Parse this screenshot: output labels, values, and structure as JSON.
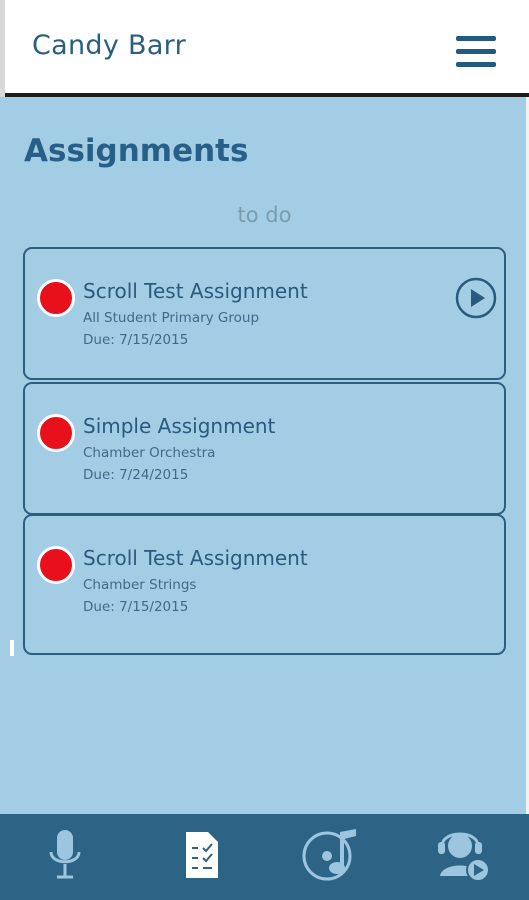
{
  "header": {
    "title": "Candy Barr",
    "menu_icon": "hamburger-menu-icon"
  },
  "main": {
    "title": "Assignments",
    "section_label": "to do",
    "assignments": [
      {
        "title": "Scroll Test Assignment",
        "group": "All Student Primary Group",
        "due": "Due: 7/15/2015",
        "status_color": "#e8101b",
        "has_play": true
      },
      {
        "title": "Simple Assignment",
        "group": "Chamber Orchestra",
        "due": "Due: 7/24/2015",
        "status_color": "#e8101b",
        "has_play": false
      },
      {
        "title": "Scroll Test Assignment",
        "group": "Chamber Strings",
        "due": "Due: 7/15/2015",
        "status_color": "#e8101b",
        "has_play": false
      }
    ]
  },
  "bottom_nav": {
    "items": [
      {
        "icon": "microphone-icon"
      },
      {
        "icon": "assignment-checklist-icon",
        "active": true
      },
      {
        "icon": "music-disc-icon"
      },
      {
        "icon": "support-headset-icon"
      }
    ]
  },
  "colors": {
    "background": "#a2cde4",
    "accent": "#285f86",
    "status_red": "#e8101b",
    "nav_bar": "#2d6485"
  }
}
